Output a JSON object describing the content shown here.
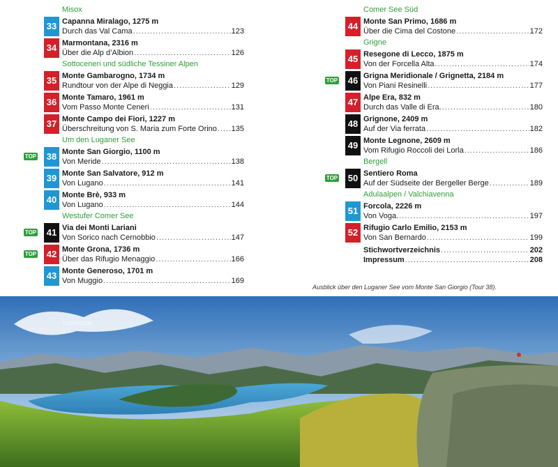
{
  "left_column": [
    {
      "section": "Misox"
    },
    {
      "num": "33",
      "color": "blue",
      "top": false,
      "title": "Capanna Miralago, 1275 m",
      "sub": "Durch das Val Cama",
      "page": "123"
    },
    {
      "num": "34",
      "color": "red",
      "top": false,
      "title": "Marmontana, 2316 m",
      "sub": "Über die Alp d’Albion",
      "page": "126"
    },
    {
      "section": "Sottoceneri und südliche Tessiner Alpen"
    },
    {
      "num": "35",
      "color": "red",
      "top": false,
      "title": "Monte Gambarogno, 1734 m",
      "sub": "Rundtour von der Alpe di Neggia",
      "page": "129"
    },
    {
      "num": "36",
      "color": "red",
      "top": false,
      "title": "Monte Tamaro, 1961 m",
      "sub": "Vom Passo Monte Ceneri",
      "page": "131"
    },
    {
      "num": "37",
      "color": "red",
      "top": false,
      "title": "Monte Campo dei Fiori, 1227 m",
      "sub": "Überschreitung von S. Maria zum Forte Orino",
      "page": "135"
    },
    {
      "section": "Um den Luganer See"
    },
    {
      "num": "38",
      "color": "blue",
      "top": true,
      "title": "Monte San Giorgio, 1100 m",
      "sub": "Von Meride",
      "page": "138"
    },
    {
      "num": "39",
      "color": "blue",
      "top": false,
      "title": "Monte San Salvatore, 912 m",
      "sub": "Von Lugano",
      "page": "141"
    },
    {
      "num": "40",
      "color": "blue",
      "top": false,
      "title": "Monte Brè, 933 m",
      "sub": "Von Lugano",
      "page": "144"
    },
    {
      "section": "Westufer Comer See"
    },
    {
      "num": "41",
      "color": "black",
      "top": true,
      "title": "Via dei Monti Lariani",
      "sub": "Von Sorico nach Cernobbio",
      "page": "147"
    },
    {
      "num": "42",
      "color": "red",
      "top": true,
      "title": "Monte Grona, 1736 m",
      "sub": "Über das Rifugio Menaggio",
      "page": "166"
    },
    {
      "num": "43",
      "color": "blue",
      "top": false,
      "title": "Monte Generoso, 1701 m",
      "sub": "Von Muggio",
      "page": "169"
    }
  ],
  "right_column": [
    {
      "section": "Comer See Süd"
    },
    {
      "num": "44",
      "color": "red",
      "top": false,
      "title": "Monte San Primo, 1686 m",
      "sub": "Über die Cima del Costone",
      "page": "172"
    },
    {
      "section": "Grigne"
    },
    {
      "num": "45",
      "color": "red",
      "top": false,
      "title": "Resegone di Lecco, 1875 m",
      "sub": "Von der Forcella Alta",
      "page": "174"
    },
    {
      "num": "46",
      "color": "black",
      "top": true,
      "title": "Grigna Meridionale / Grignetta, 2184 m",
      "sub": "Von Piani Resinelli",
      "page": "177"
    },
    {
      "num": "47",
      "color": "red",
      "top": false,
      "title": "Alpe Era, 832 m",
      "sub": "Durch das Valle di Era.",
      "page": "180"
    },
    {
      "num": "48",
      "color": "black",
      "top": false,
      "title": "Grignone, 2409 m",
      "sub": "Auf der Via ferrata",
      "page": "182"
    },
    {
      "num": "49",
      "color": "black",
      "top": false,
      "title": "Monte Legnone, 2609 m",
      "sub": "Vom Rifugio Roccoli dei Lorla",
      "page": "186"
    },
    {
      "section": "Bergell"
    },
    {
      "num": "50",
      "color": "black",
      "top": true,
      "title": "Sentiero Roma",
      "sub": "Auf der Südseite der Bergeller Berge",
      "page": "189"
    },
    {
      "section": "Adulaalpen / Valchiavenna"
    },
    {
      "num": "51",
      "color": "blue",
      "top": false,
      "title": "Forcola, 2226 m",
      "sub": "Von Voga.",
      "page": "197"
    },
    {
      "num": "52",
      "color": "red",
      "top": false,
      "title": "Rifugio Carlo Emilio, 2153 m",
      "sub": "Von San Bernardo",
      "page": "199"
    }
  ],
  "extras": [
    {
      "label": "Stichwortverzeichnis",
      "page": "202"
    },
    {
      "label": "Impressum",
      "page": "208"
    }
  ],
  "top_badge_label": "TOP",
  "dot_leader": "................................................................................................",
  "caption": "Ausblick über den Luganer See vom Monte San Giorgio (Tour 38).",
  "watermark": "Leseprobe",
  "photo": {
    "icon": "panorama-lake-photo"
  },
  "colors": {
    "blue": "#1f97d4",
    "red": "#d4202a",
    "black": "#111111",
    "section_green": "#2f9e3a",
    "top_badge": "#2f9e3a"
  }
}
